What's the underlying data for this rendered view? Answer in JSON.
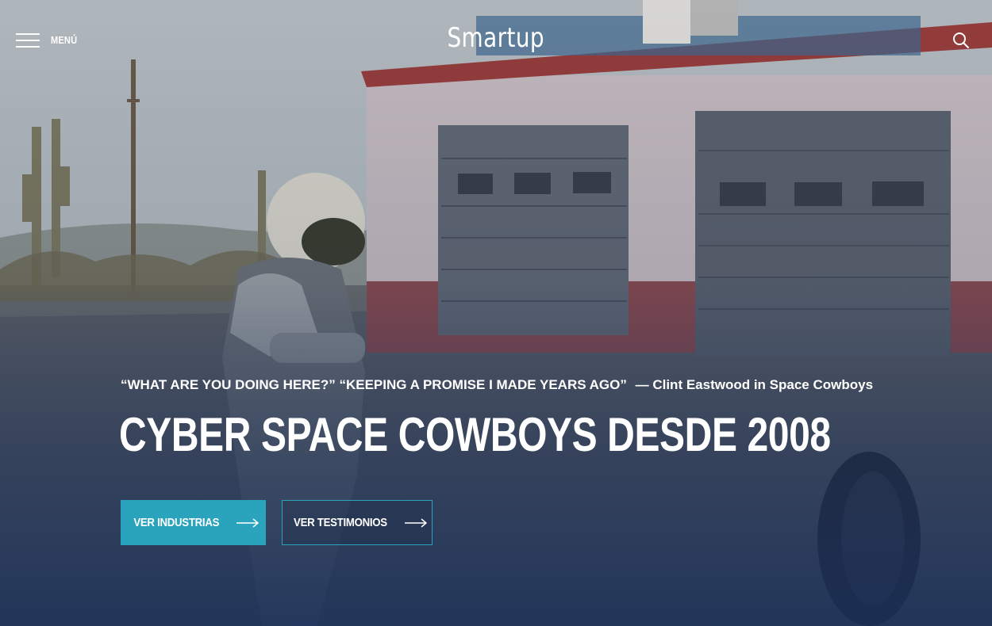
{
  "header": {
    "menu_label": "MENÚ",
    "logo_text": "Smartup",
    "menu_icon": "hamburger-icon",
    "search_icon": "search-icon"
  },
  "hero": {
    "quote": "“WHAT ARE YOU DOING HERE?” “KEEPING A PROMISE I MADE YEARS AGO”",
    "quote_author": "— Clint Eastwood in Space Cowboys",
    "headline": "CYBER SPACE COWBOYS DESDE 2008",
    "buttons": [
      {
        "label": "VER INDUSTRIAS",
        "icon": "arrow-right-icon"
      },
      {
        "label": "VER TESTIMONIOS",
        "icon": "arrow-right-icon"
      }
    ]
  },
  "colors": {
    "accent": "#2aa3bd",
    "text": "#ffffff",
    "overlay_dark": "#1e3356"
  }
}
